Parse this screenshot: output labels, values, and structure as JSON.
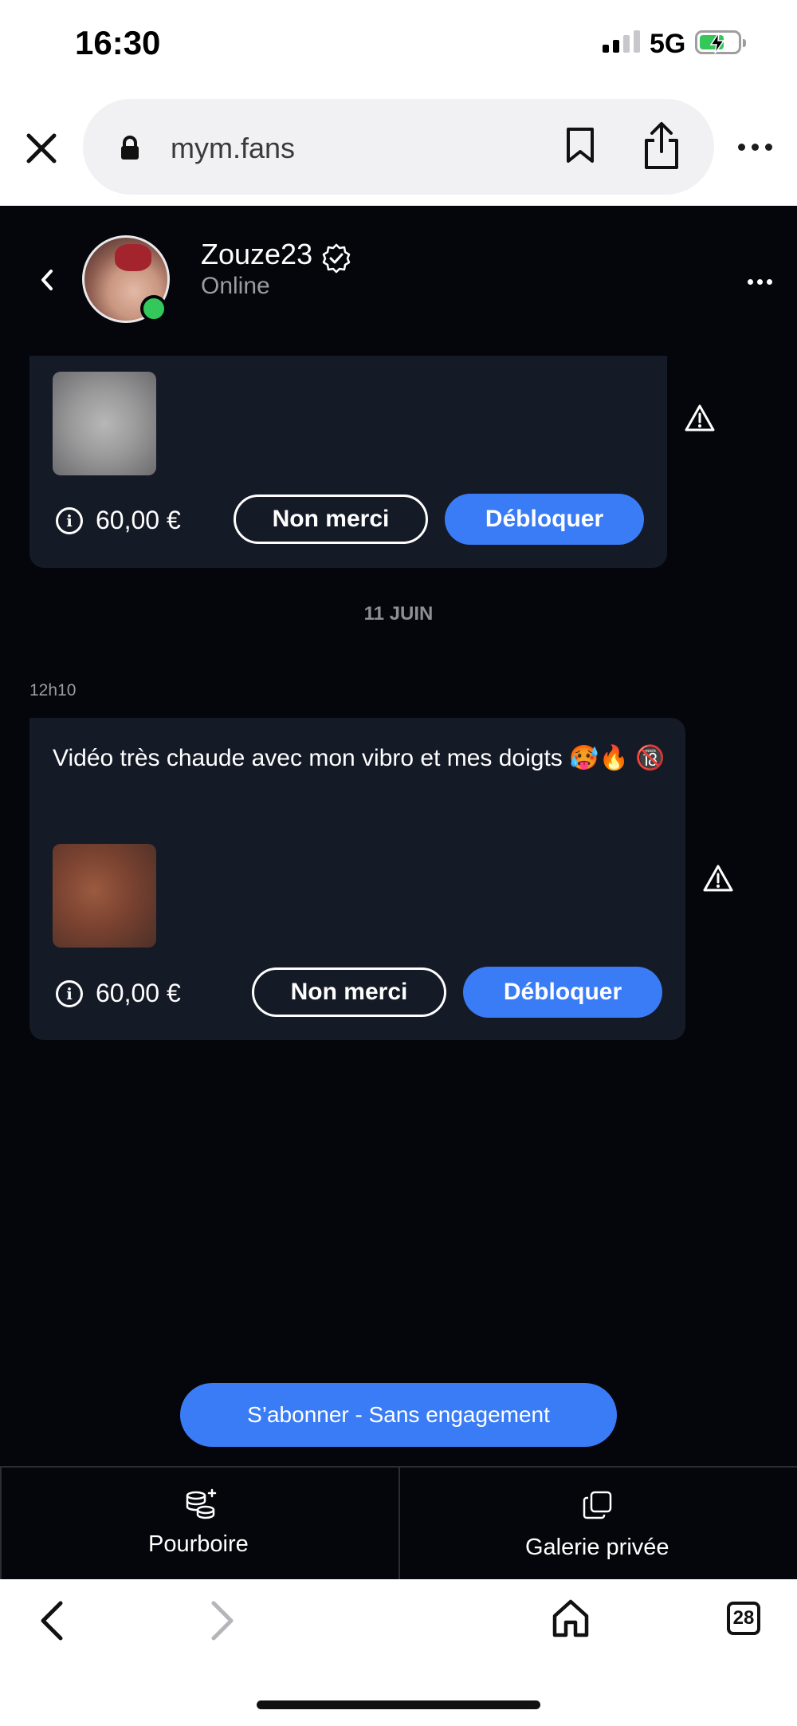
{
  "status_bar": {
    "time": "16:30",
    "network": "5G",
    "battery_color": "#34c759"
  },
  "browser": {
    "url": "mym.fans",
    "close_icon": "close-icon",
    "tabs_count": "28"
  },
  "chat_header": {
    "username": "Zouze23",
    "status": "Online",
    "online_color": "#34c759"
  },
  "messages": [
    {
      "price": "60,00 €",
      "decline_label": "Non merci",
      "unlock_label": "Débloquer"
    },
    {
      "time": "12h10",
      "text": "Vidéo très chaude avec mon vibro et mes doigts 🥵🔥 🔞",
      "price": "60,00 €",
      "decline_label": "Non merci",
      "unlock_label": "Débloquer"
    }
  ],
  "date_separator": "11 JUIN",
  "subscribe_label": "S’abonner - Sans engagement",
  "bottom_actions": {
    "tip_label": "Pourboire",
    "gallery_label": "Galerie privée"
  },
  "accent_color": "#3a7cf6"
}
